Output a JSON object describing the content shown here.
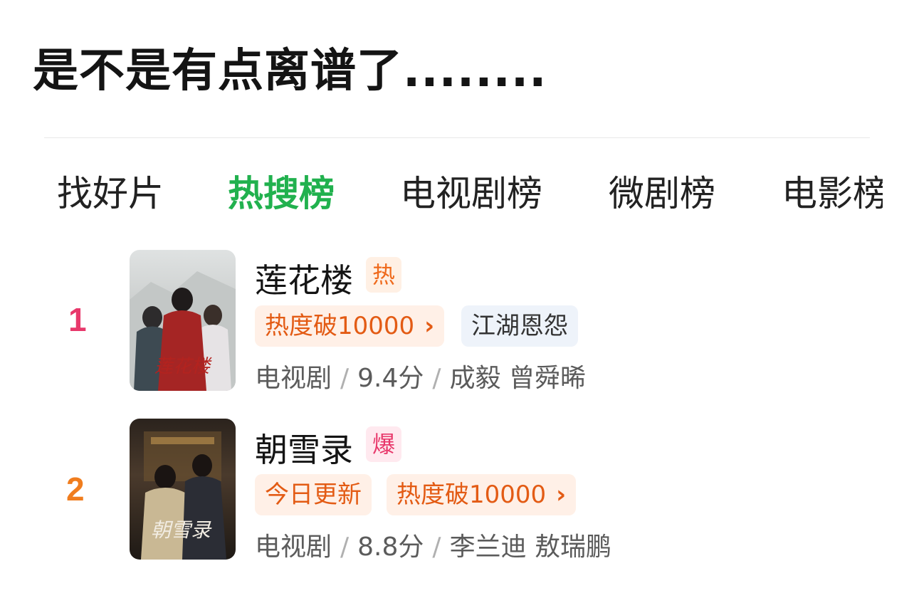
{
  "post": {
    "title": "是不是有点离谱了........"
  },
  "tabs": [
    {
      "label": "找好片",
      "active": false
    },
    {
      "label": "热搜榜",
      "active": true
    },
    {
      "label": "电视剧榜",
      "active": false
    },
    {
      "label": "微剧榜",
      "active": false
    },
    {
      "label": "电影榜",
      "active": false
    }
  ],
  "rankings": [
    {
      "rank": "1",
      "title": "莲花楼",
      "tag": "热",
      "chips": [
        "热度破10000",
        "江湖恩怨"
      ],
      "chip_arrow": "›",
      "meta": {
        "type": "电视剧",
        "score": "9.4分",
        "cast": "成毅 曾舜晞"
      },
      "poster_text": "莲花楼"
    },
    {
      "rank": "2",
      "title": "朝雪录",
      "tag": "爆",
      "chips": [
        "今日更新",
        "热度破10000"
      ],
      "chip_arrow": "›",
      "meta": {
        "type": "电视剧",
        "score": "8.8分",
        "cast": "李兰迪 敖瑞鹏"
      },
      "poster_text": "朝雪录"
    }
  ],
  "meta_separator": "/",
  "colors": {
    "active_tab": "#21b14e",
    "rank_1": "#e8386b",
    "rank_2": "#f07d1e",
    "hot_chip_text": "#e35b14"
  }
}
